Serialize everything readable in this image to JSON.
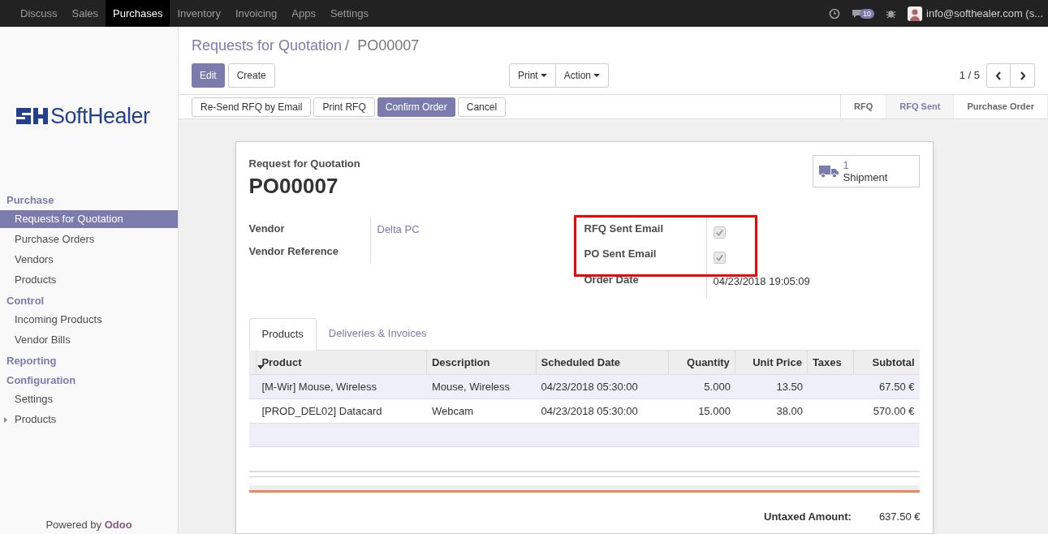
{
  "top_menu": [
    {
      "label": "Discuss",
      "selected": false
    },
    {
      "label": "Sales",
      "selected": false
    },
    {
      "label": "Purchases",
      "selected": true
    },
    {
      "label": "Inventory",
      "selected": false
    },
    {
      "label": "Invoicing",
      "selected": false
    },
    {
      "label": "Apps",
      "selected": false
    },
    {
      "label": "Settings",
      "selected": false
    }
  ],
  "top_right": {
    "chat_count": "10",
    "user": "info@softhealer.com (s..."
  },
  "logo": {
    "text": "SoftHealer"
  },
  "sidebar": [
    {
      "title": "Purchase",
      "items": [
        {
          "label": "Requests for Quotation",
          "selected": true
        },
        {
          "label": "Purchase Orders",
          "selected": false
        },
        {
          "label": "Vendors",
          "selected": false
        },
        {
          "label": "Products",
          "selected": false
        }
      ]
    },
    {
      "title": "Control",
      "items": [
        {
          "label": "Incoming Products",
          "selected": false
        },
        {
          "label": "Vendor Bills",
          "selected": false
        }
      ]
    },
    {
      "title": "Reporting"
    },
    {
      "title": "Configuration",
      "items": [
        {
          "label": "Settings",
          "selected": false
        },
        {
          "label": "Products",
          "selected": false,
          "expanded": false
        }
      ]
    }
  ],
  "powered_by": {
    "text": "Powered by",
    "brand": "Odoo"
  },
  "breadcrumb": {
    "parent": "Requests for Quotation",
    "separator": "/",
    "current": "PO00007"
  },
  "control_buttons": {
    "edit": "Edit",
    "create": "Create",
    "print": "Print",
    "action": "Action",
    "pager": "1 / 5"
  },
  "status_buttons": [
    {
      "label": "Re-Send RFQ by Email",
      "kind": "default"
    },
    {
      "label": "Print RFQ",
      "kind": "default"
    },
    {
      "label": "Confirm Order",
      "kind": "primary"
    },
    {
      "label": "Cancel",
      "kind": "default"
    }
  ],
  "status_steps": [
    {
      "label": "RFQ",
      "selected": false
    },
    {
      "label": "RFQ Sent",
      "selected": true
    },
    {
      "label": "Purchase Order",
      "selected": false
    }
  ],
  "sheet": {
    "subtitle": "Request for Quotation",
    "name": "PO00007",
    "shipment_count": "1",
    "shipment_label": "Shipment",
    "left_fields": [
      {
        "label": "Vendor",
        "value": "Delta PC"
      },
      {
        "label": "Vendor Reference"
      }
    ],
    "checkbox_fields": [
      {
        "label": "RFQ Sent Email",
        "checked": true
      },
      {
        "label": "PO Sent Email",
        "checked": true
      }
    ],
    "order_date": {
      "label": "Order Date",
      "value": "04/23/2018 19:05:09"
    },
    "tabs": [
      {
        "label": "Products",
        "selected": true
      },
      {
        "label": "Deliveries & Invoices",
        "selected": false
      }
    ],
    "table": {
      "columns": [
        "Product",
        "Description",
        "Scheduled Date",
        "Quantity",
        "Unit Price",
        "Taxes",
        "Subtotal"
      ],
      "rows": [
        [
          "[M-Wir] Mouse, Wireless",
          "Mouse, Wireless",
          "04/23/2018 05:30:00",
          "5.000",
          "13.50",
          "",
          "67.50 €"
        ],
        [
          "[PROD_DEL02] Datacard",
          "Webcam",
          "04/23/2018 05:30:00",
          "15.000",
          "38.00",
          "",
          "570.00 €"
        ]
      ]
    },
    "untaxed": {
      "label": "Untaxed Amount:",
      "value": "637.50 €"
    }
  }
}
